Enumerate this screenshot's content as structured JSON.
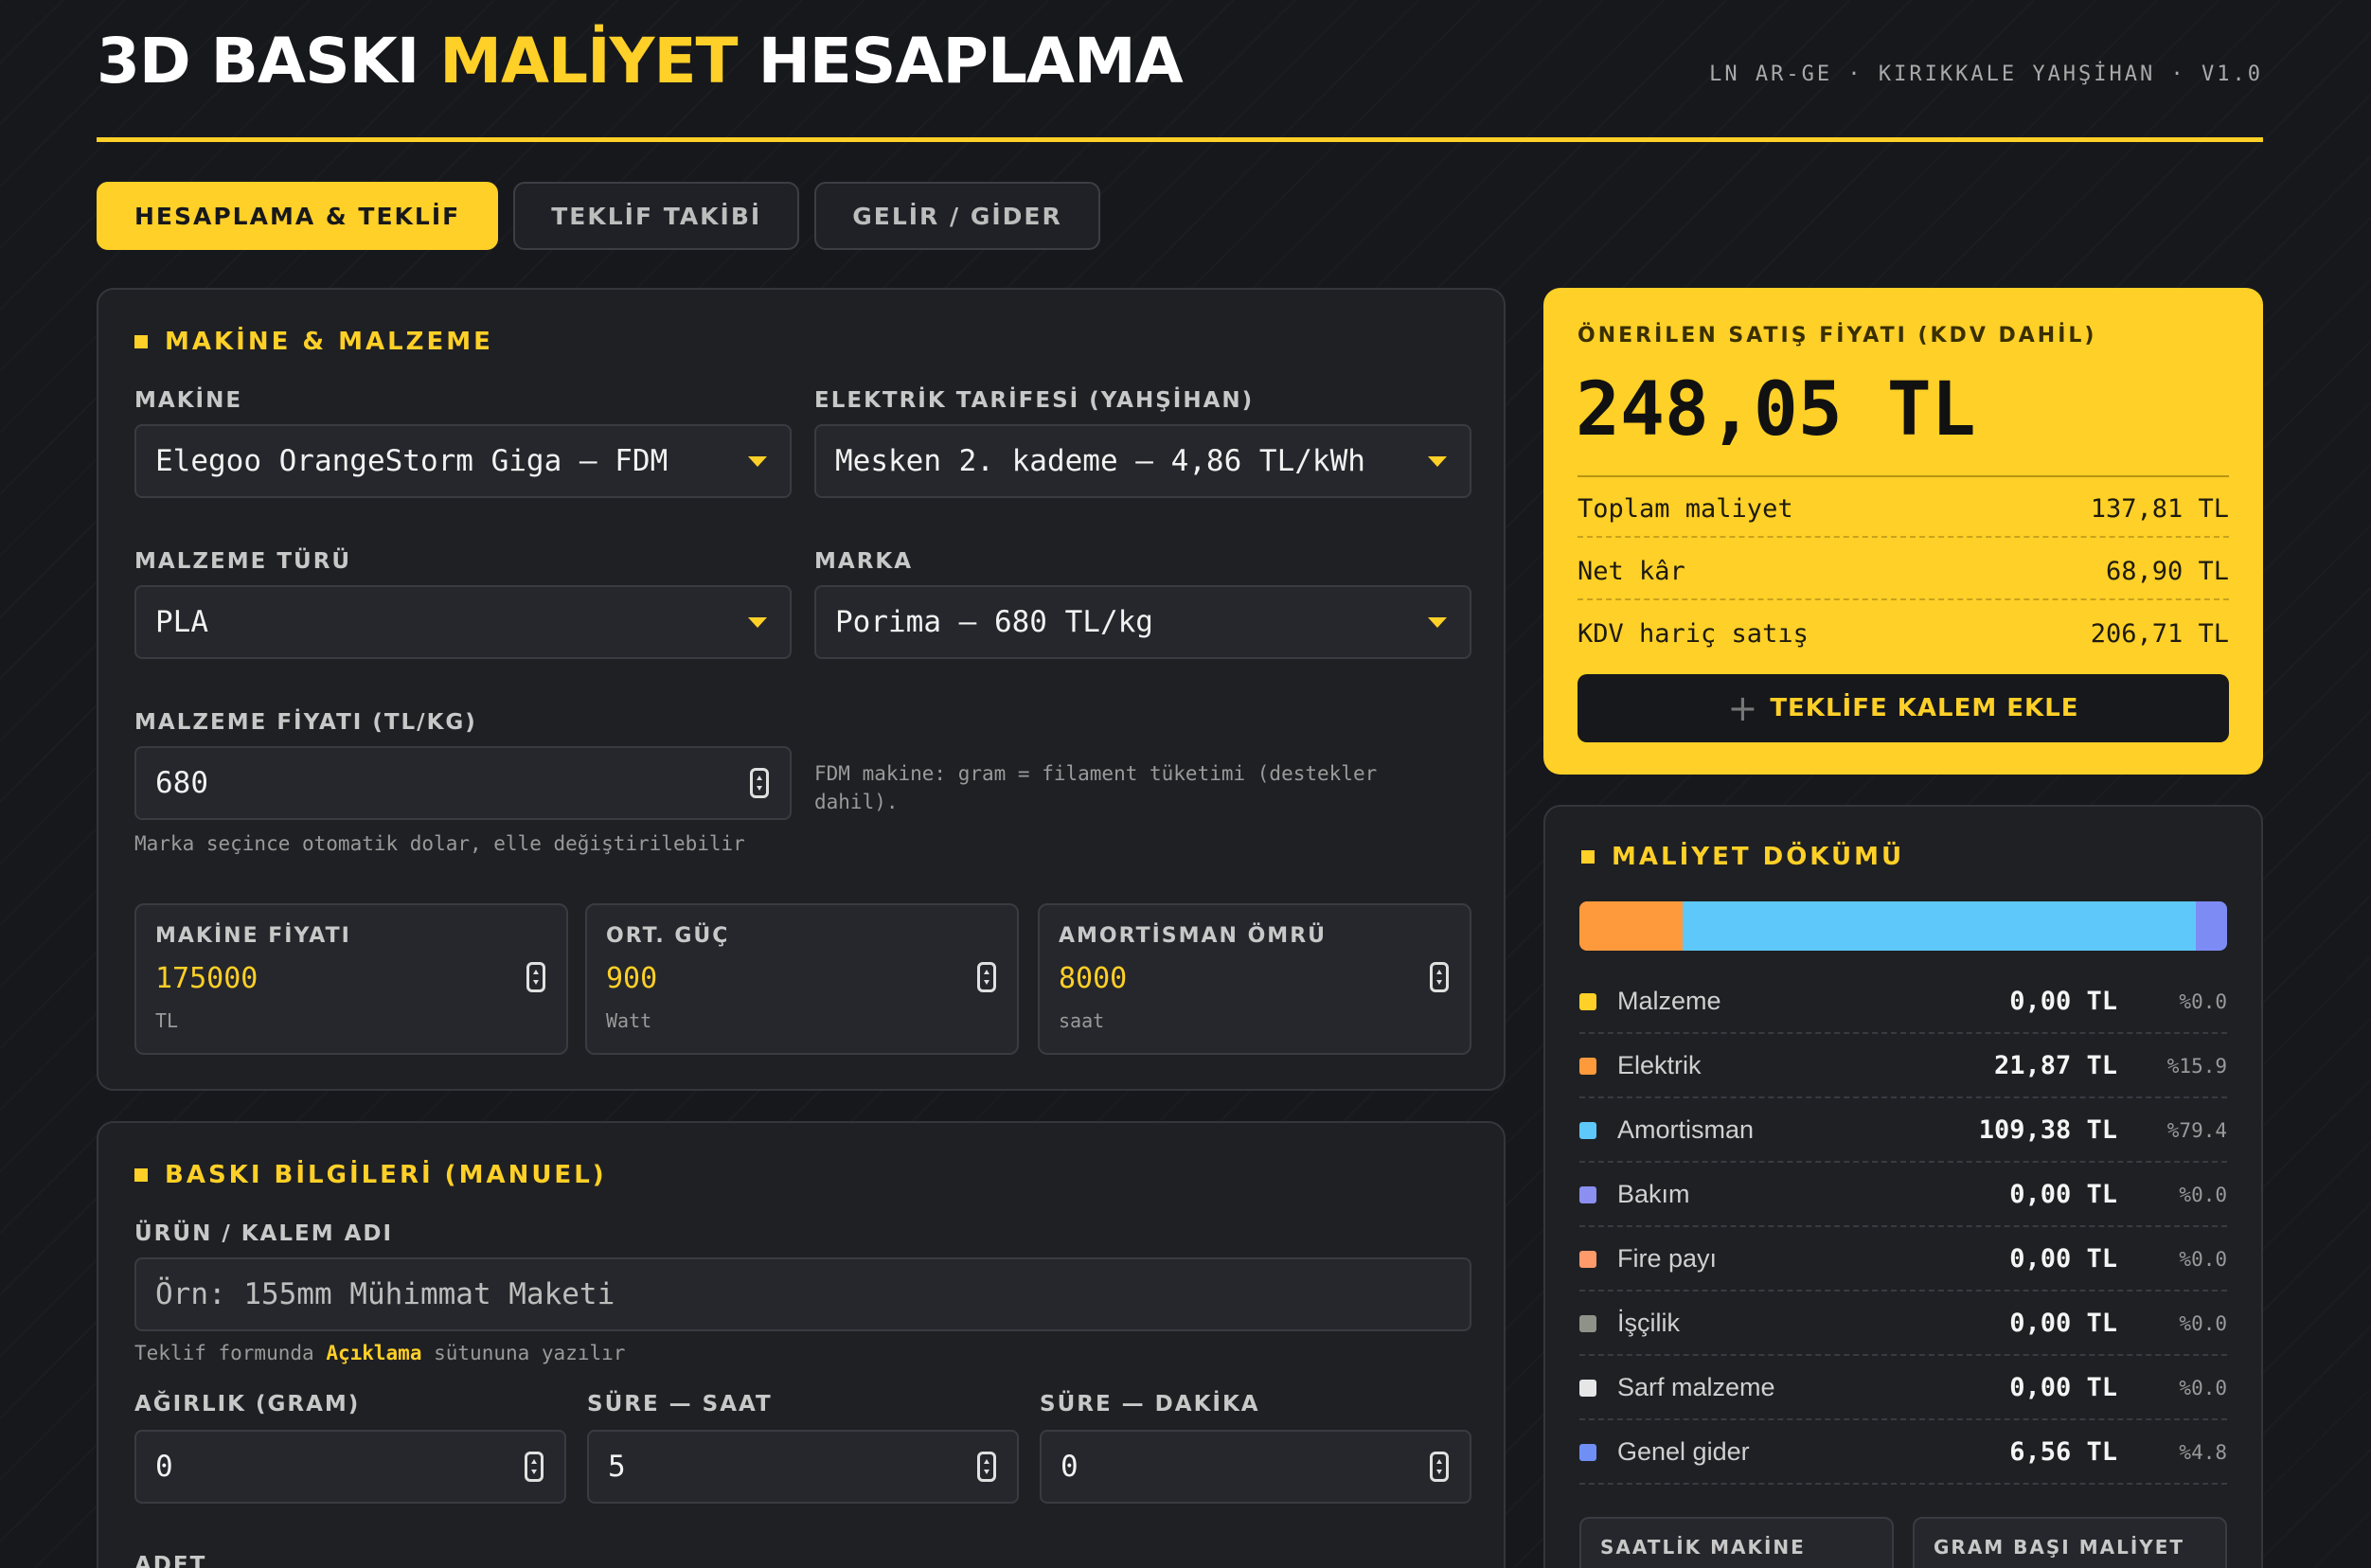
{
  "header": {
    "title_part1": "3D BASKI",
    "title_part2": "MALİYET",
    "title_part3": "HESAPLAMA",
    "org": "LN AR-GE · KIRIKKALE YAHŞİHAN · V1.0"
  },
  "tabs": [
    {
      "label": "HESAPLAMA & TEKLİF",
      "active": true
    },
    {
      "label": "TEKLİF TAKİBİ",
      "active": false
    },
    {
      "label": "GELİR / GİDER",
      "active": false
    }
  ],
  "machine_section": {
    "title": "MAKİNE & MALZEME",
    "machine": {
      "label": "MAKİNE",
      "value": "Elegoo OrangeStorm Giga — FDM"
    },
    "tariff": {
      "label": "ELEKTRİK TARİFESİ (YAHŞİHAN)",
      "value": "Mesken 2. kademe — 4,86 TL/kWh"
    },
    "material_type": {
      "label": "MALZEME TÜRÜ",
      "value": "PLA"
    },
    "brand": {
      "label": "MARKA",
      "value": "Porima — 680 TL/kg"
    },
    "material_price": {
      "label": "MALZEME FİYATI (TL/KG)",
      "value": "680",
      "hint": "Marka seçince otomatik dolar, elle değiştirilebilir"
    },
    "fdm_note": "FDM makine: gram = filament tüketimi (destekler dahil).",
    "machine_price": {
      "label": "MAKİNE FİYATI",
      "value": "175000",
      "unit": "TL"
    },
    "avg_power": {
      "label": "ORT. GÜÇ",
      "value": "900",
      "unit": "Watt"
    },
    "amortization": {
      "label": "AMORTİSMAN ÖMRÜ",
      "value": "8000",
      "unit": "saat"
    }
  },
  "print_section": {
    "title": "BASKI BİLGİLERİ (MANUEL)",
    "product_name": {
      "label": "ÜRÜN / KALEM ADI",
      "placeholder": "Örn: 155mm Mühimmat Maketi"
    },
    "product_hint_pre": "Teklif formunda",
    "product_hint_bold": "Açıklama",
    "product_hint_post": "sütununa yazılır",
    "weight": {
      "label": "AĞIRLIK (GRAM)",
      "value": "0"
    },
    "hours": {
      "label": "SÜRE — SAAT",
      "value": "5"
    },
    "minutes": {
      "label": "SÜRE — DAKİKA",
      "value": "0"
    },
    "qty_label": "ADET"
  },
  "price_card": {
    "label": "ÖNERİLEN SATIŞ FİYATI (KDV DAHİL)",
    "value": "248,05 TL",
    "rows": [
      {
        "label": "Toplam maliyet",
        "value": "137,81 TL"
      },
      {
        "label": "Net kâr",
        "value": "68,90 TL"
      },
      {
        "label": "KDV hariç satış",
        "value": "206,71 TL"
      }
    ],
    "add_button": "TEKLİFE KALEM EKLE",
    "add_icon": "plus-icon"
  },
  "breakdown": {
    "title": "MALİYET DÖKÜMÜ",
    "bar_segments": [
      {
        "name": "Elektrik",
        "pct": 15.9,
        "color": "#ff9a3c"
      },
      {
        "name": "Amortisman",
        "pct": 79.4,
        "color": "#5ec8fa"
      },
      {
        "name": "Genel gider",
        "pct": 4.8,
        "color": "#7d8cf5"
      }
    ],
    "rows": [
      {
        "name": "Malzeme",
        "amount": "0,00 TL",
        "pct": "%0.0",
        "color": "#ffd027"
      },
      {
        "name": "Elektrik",
        "amount": "21,87 TL",
        "pct": "%15.9",
        "color": "#ff9a3c"
      },
      {
        "name": "Amortisman",
        "amount": "109,38 TL",
        "pct": "%79.4",
        "color": "#5ec8fa"
      },
      {
        "name": "Bakım",
        "amount": "0,00 TL",
        "pct": "%0.0",
        "color": "#8a8ff0"
      },
      {
        "name": "Fire payı",
        "amount": "0,00 TL",
        "pct": "%0.0",
        "color": "#ff9a6a"
      },
      {
        "name": "İşçilik",
        "amount": "0,00 TL",
        "pct": "%0.0",
        "color": "#8e9288"
      },
      {
        "name": "Sarf malzeme",
        "amount": "0,00 TL",
        "pct": "%0.0",
        "color": "#e6e6e6"
      },
      {
        "name": "Genel gider",
        "amount": "6,56 TL",
        "pct": "%4.8",
        "color": "#6f8ff5"
      }
    ],
    "kpi_hourly": "SAATLİK MAKİNE",
    "kpi_gram": "GRAM BAŞI MALİYET"
  }
}
